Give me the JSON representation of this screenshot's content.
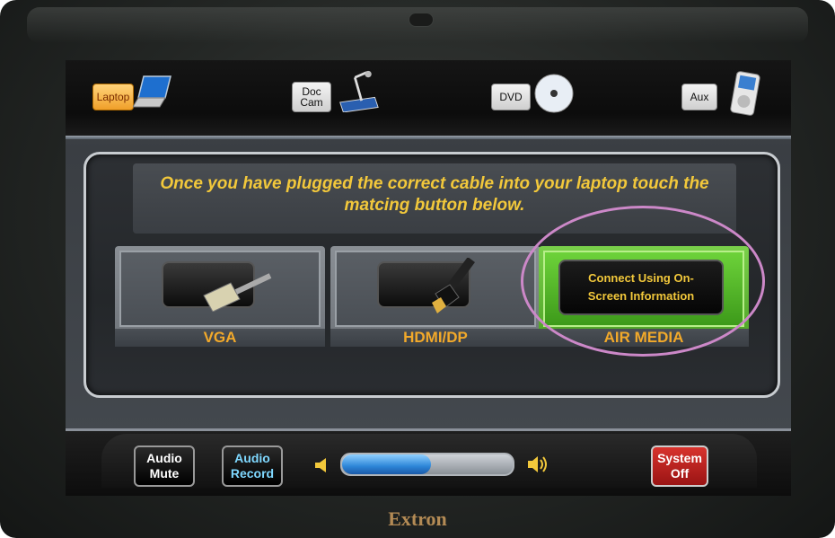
{
  "device": {
    "brand": "Extron"
  },
  "sources": {
    "laptop": {
      "label": "Laptop",
      "active": true
    },
    "doccam": {
      "label": "Doc\nCam"
    },
    "dvd": {
      "label": "DVD"
    },
    "aux": {
      "label": "Aux"
    }
  },
  "instruction": "Once you have plugged the correct cable into your laptop touch the matcing button below.",
  "inputs": {
    "vga": {
      "caption": "VGA"
    },
    "hdmi": {
      "caption": "HDMI/DP"
    },
    "air": {
      "caption": "AIR MEDIA",
      "button": "Connect Using On-\nScreen Information"
    }
  },
  "controls": {
    "audio_mute": "Audio\nMute",
    "audio_record": "Audio\nRecord",
    "system_off": "System\nOff",
    "volume_fraction": 0.52
  },
  "colors": {
    "active_source": "#f0a02a",
    "instruction_text": "#f2c83b",
    "air_media": "#4ba024",
    "system_off": "#d8332d",
    "annotation": "#cc88c8"
  }
}
